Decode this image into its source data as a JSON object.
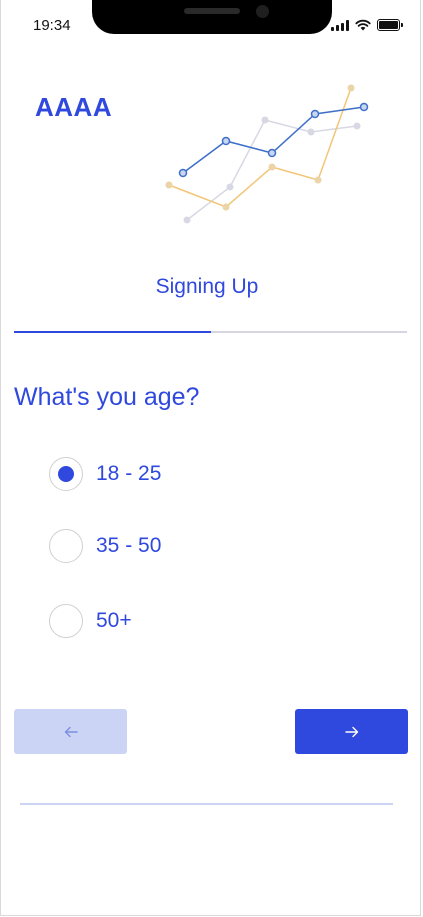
{
  "status_bar": {
    "time": "19:34",
    "icons": [
      "signal-icon",
      "wifi-icon",
      "battery-icon"
    ]
  },
  "brand": {
    "logo_text": "AAAA"
  },
  "header": {
    "title": "Signing Up"
  },
  "progress": {
    "fraction": 0.5
  },
  "question": {
    "text": "What's you age?",
    "options": [
      {
        "label": "18 - 25",
        "selected": true
      },
      {
        "label": "35 - 50",
        "selected": false
      },
      {
        "label": "50+",
        "selected": false
      }
    ]
  },
  "navigation": {
    "back_icon": "arrow-left-icon",
    "next_icon": "arrow-right-icon"
  },
  "colors": {
    "accent": "#2f48dd",
    "accent_light": "#cbd4f4",
    "chart_blue": "#3e6fc9",
    "chart_orange": "#f2c677",
    "chart_gray": "#d8d8e4"
  }
}
